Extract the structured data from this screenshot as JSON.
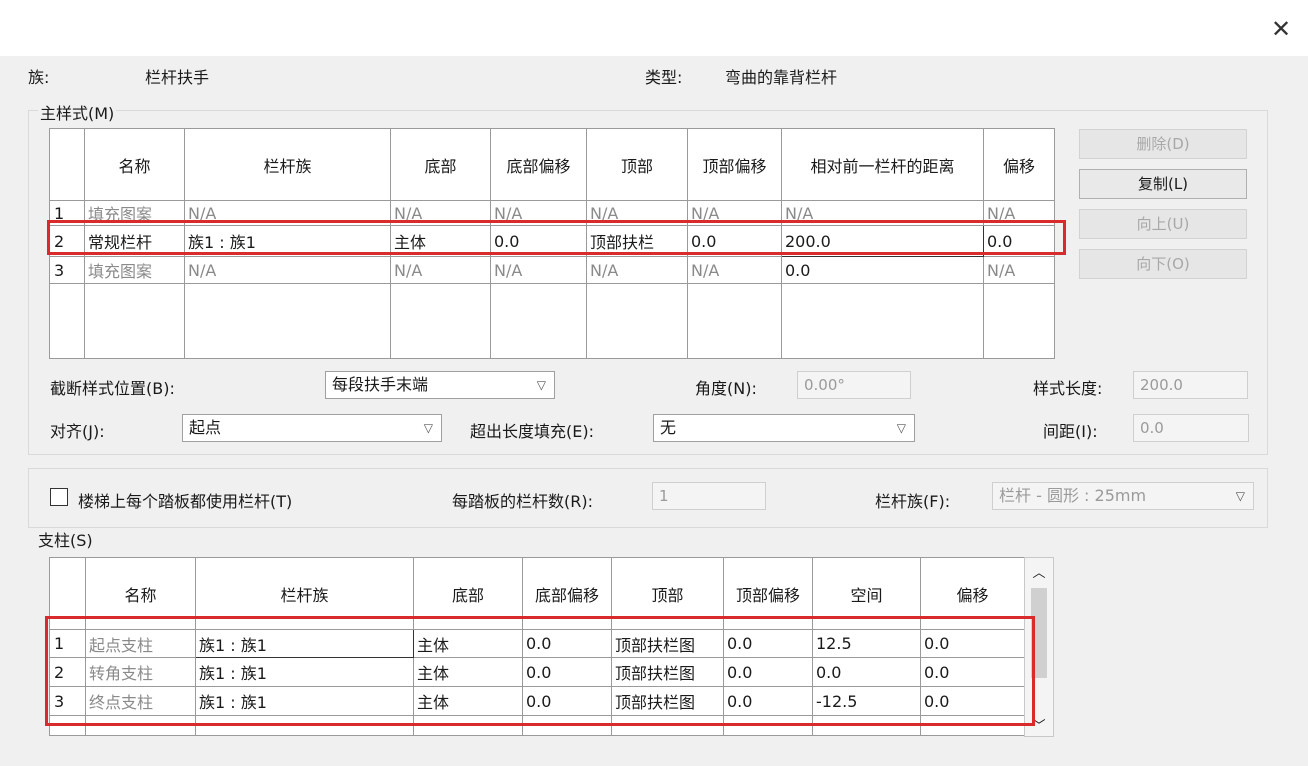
{
  "header": {
    "family_label": "族:",
    "family_value": "栏杆扶手",
    "type_label": "类型:",
    "type_value": "弯曲的靠背栏杆"
  },
  "main_pattern": {
    "group_label": "主样式(M)",
    "columns": [
      "名称",
      "栏杆族",
      "底部",
      "底部偏移",
      "顶部",
      "顶部偏移",
      "相对前一栏杆的距离",
      "偏移"
    ],
    "rows": [
      {
        "num": "1",
        "name": "填充图案",
        "family": "N/A",
        "bottom": "N/A",
        "bottom_offset": "N/A",
        "top": "N/A",
        "top_offset": "N/A",
        "distance": "N/A",
        "offset": "N/A"
      },
      {
        "num": "2",
        "name": "常规栏杆",
        "family": "族1 : 族1",
        "bottom": "主体",
        "bottom_offset": "0.0",
        "top": "顶部扶栏",
        "top_offset": "0.0",
        "distance": "200.0",
        "offset": "0.0"
      },
      {
        "num": "3",
        "name": "填充图案",
        "family": "N/A",
        "bottom": "N/A",
        "bottom_offset": "N/A",
        "top": "N/A",
        "top_offset": "N/A",
        "distance": "0.0",
        "offset": "N/A"
      }
    ]
  },
  "buttons": {
    "delete": "删除(D)",
    "copy": "复制(L)",
    "up": "向上(U)",
    "down": "向下(O)"
  },
  "break_pattern": {
    "label": "截断样式位置(B):",
    "value": "每段扶手末端"
  },
  "angle": {
    "label": "角度(N):",
    "value": "0.00°"
  },
  "pattern_length": {
    "label": "样式长度:",
    "value": "200.0"
  },
  "justify": {
    "label": "对齐(J):",
    "value": "起点"
  },
  "excess_fill": {
    "label": "超出长度填充(E):",
    "value": "无"
  },
  "spacing": {
    "label": "间距(I):",
    "value": "0.0"
  },
  "per_tread": {
    "checkbox_label": "楼梯上每个踏板都使用栏杆(T)",
    "count_label": "每踏板的栏杆数(R):",
    "count_value": "1",
    "family_label": "栏杆族(F):",
    "family_value": "栏杆 - 圆形 : 25mm"
  },
  "posts": {
    "group_label": "支柱(S)",
    "columns": [
      "名称",
      "栏杆族",
      "底部",
      "底部偏移",
      "顶部",
      "顶部偏移",
      "空间",
      "偏移"
    ],
    "rows": [
      {
        "num": "1",
        "name": "起点支柱",
        "family": "族1 : 族1",
        "bottom": "主体",
        "bottom_offset": "0.0",
        "top": "顶部扶栏图",
        "top_offset": "0.0",
        "space": "12.5",
        "offset": "0.0"
      },
      {
        "num": "2",
        "name": "转角支柱",
        "family": "族1 : 族1",
        "bottom": "主体",
        "bottom_offset": "0.0",
        "top": "顶部扶栏图",
        "top_offset": "0.0",
        "space": "0.0",
        "offset": "0.0"
      },
      {
        "num": "3",
        "name": "终点支柱",
        "family": "族1 : 族1",
        "bottom": "主体",
        "bottom_offset": "0.0",
        "top": "顶部扶栏图",
        "top_offset": "0.0",
        "space": "-12.5",
        "offset": "0.0"
      }
    ]
  },
  "icons": {
    "close": "close-icon",
    "dropdown": "chevron-down-icon",
    "scroll_up": "chevron-up-icon",
    "scroll_down": "chevron-down-icon"
  },
  "colors": {
    "highlight": "#d92b2b",
    "background": "#f0f0f0"
  }
}
